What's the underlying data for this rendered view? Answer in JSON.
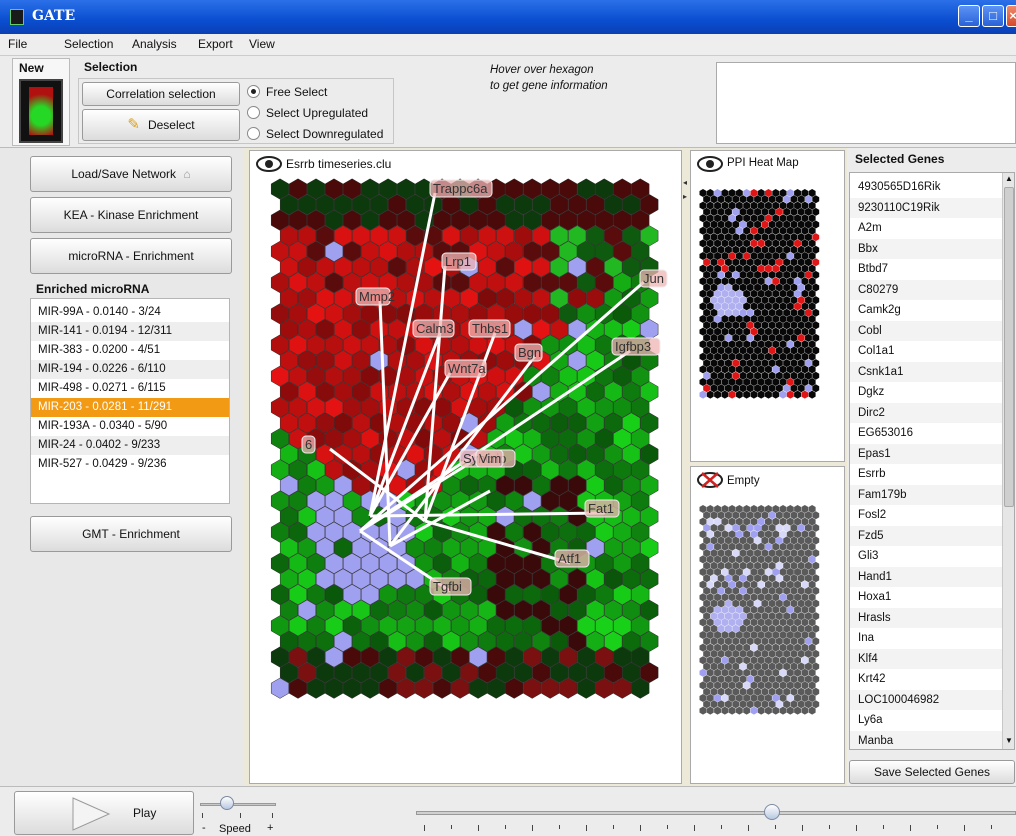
{
  "window": {
    "title": "GATE"
  },
  "menu": [
    "File",
    "Selection",
    "Analysis",
    "Export",
    "View"
  ],
  "toolbar": {
    "new_label": "New",
    "selection_label": "Selection",
    "correlation_button": "Correlation selection",
    "deselect_button": "Deselect",
    "radio_options": [
      "Free Select",
      "Select Upregulated",
      "Select Downregulated"
    ],
    "selected_radio": "Free Select",
    "hover_hint_line1": "Hover over hexagon",
    "hover_hint_line2": "to get gene information"
  },
  "sidebar": {
    "load_save_button": "Load/Save Network",
    "kea_button": "KEA - Kinase Enrichment",
    "microrna_button": "microRNA - Enrichment",
    "enriched_label": "Enriched microRNA",
    "mirna_items": [
      "MIR-99A - 0.0140 - 3/24",
      "MIR-141 - 0.0194 - 12/311",
      "MIR-383 - 0.0200 - 4/51",
      "MIR-194 - 0.0226 - 6/110",
      "MIR-498 - 0.0271 - 6/115",
      "MIR-203 - 0.0281 - 11/291",
      "MIR-193A - 0.0340 - 5/90",
      "MIR-24 - 0.0402 - 9/233",
      "MIR-527 - 0.0429 - 9/236"
    ],
    "selected_mirna": "MIR-203 - 0.0281 - 11/291",
    "gmt_button": "GMT - Enrichment"
  },
  "main_map": {
    "title": "Esrrb timeseries.clu",
    "gene_labels": [
      "Trappc6a",
      "Lrp1",
      "Jun",
      "Mmp2",
      "Calm3",
      "Thbs1",
      "Igfbp3",
      "Bgn",
      "Wnt7a",
      "6",
      "Syncrip",
      "Fat1",
      "Atf1",
      "Tgfbi",
      "Vim"
    ]
  },
  "ppi_panel": {
    "title": "PPI Heat Map"
  },
  "empty_panel": {
    "title": "Empty"
  },
  "selected_genes": {
    "title": "Selected Genes",
    "items": [
      "4930565D16Rik",
      "9230110C19Rik",
      "A2m",
      "Bbx",
      "Btbd7",
      "C80279",
      "Camk2g",
      "Cobl",
      "Col1a1",
      "Csnk1a1",
      "Dgkz",
      "Dirc2",
      "EG653016",
      "Epas1",
      "Esrrb",
      "Fam179b",
      "Fosl2",
      "Fzd5",
      "Gli3",
      "Hand1",
      "Hoxa1",
      "Hrasls",
      "Ina",
      "Klf4",
      "Krt42",
      "LOC100046982",
      "Ly6a",
      "Manba"
    ],
    "save_button": "Save Selected Genes"
  },
  "playback": {
    "play_button": "Play",
    "speed_label": "Speed",
    "speed_minus": "-",
    "speed_plus": "+"
  },
  "colors": {
    "selected_row": "#f29a14",
    "up_red": "#e51010",
    "down_green": "#18c818",
    "selected_hex": "#a0a0f0"
  }
}
